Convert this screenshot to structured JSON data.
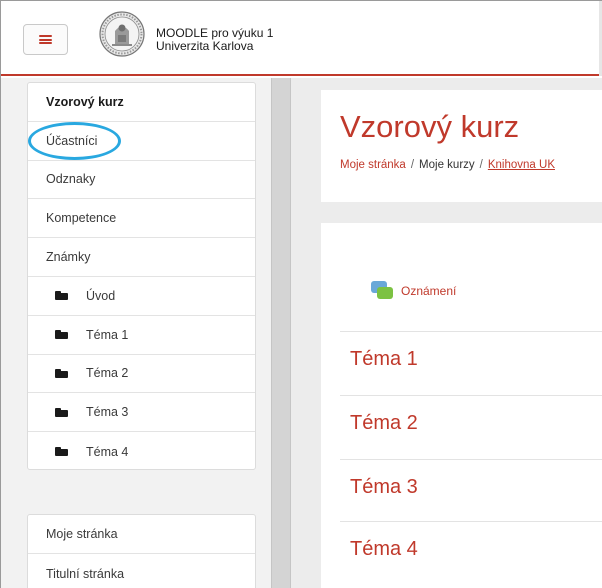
{
  "header": {
    "site_name_line1": "MOODLE pro výuku 1",
    "site_name_line2": "Univerzita Karlova",
    "accent_color": "#c0392b"
  },
  "sidebar": {
    "nav_items": [
      {
        "label": "Vzorový kurz",
        "icon": null
      },
      {
        "label": "Účastníci",
        "icon": null
      },
      {
        "label": "Odznaky",
        "icon": null
      },
      {
        "label": "Kompetence",
        "icon": null
      },
      {
        "label": "Známky",
        "icon": null
      },
      {
        "label": "Úvod",
        "icon": "folder-icon"
      },
      {
        "label": "Téma 1",
        "icon": "folder-icon"
      },
      {
        "label": "Téma 2",
        "icon": "folder-icon"
      },
      {
        "label": "Téma 3",
        "icon": "folder-icon"
      },
      {
        "label": "Téma 4",
        "icon": "folder-icon"
      }
    ],
    "site_items": [
      {
        "label": "Moje stránka"
      },
      {
        "label": "Titulní stránka"
      }
    ],
    "highlight_color": "#29a8e0"
  },
  "main": {
    "title": "Vzorový kurz",
    "breadcrumb": {
      "items": [
        "Moje stránka",
        "Moje kurzy",
        "Knihovna UK"
      ],
      "separator": "/"
    },
    "forum_label": "Oznámení",
    "sections": [
      "Téma 1",
      "Téma 2",
      "Téma 3",
      "Téma 4"
    ]
  }
}
